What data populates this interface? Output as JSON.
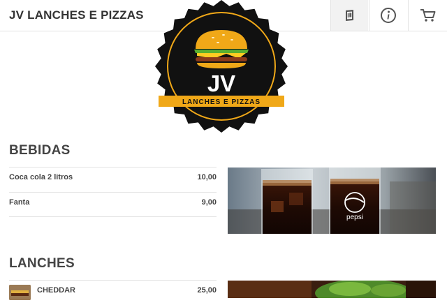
{
  "header": {
    "title": "JV LANCHES E PIZZAS",
    "buttons": [
      {
        "icon": "menu-book-icon"
      },
      {
        "icon": "info-icon"
      },
      {
        "icon": "cart-icon"
      }
    ]
  },
  "logo": {
    "initials": "JV",
    "tagline": "LANCHES E PIZZAS",
    "colors": {
      "badge": "#111111",
      "ring": "#f0a818",
      "banner": "#f0a818"
    }
  },
  "sections": [
    {
      "title": "BEBIDAS",
      "items": [
        {
          "name": "Coca cola 2 litros",
          "price": "10,00"
        },
        {
          "name": "Fanta",
          "price": "9,00"
        }
      ],
      "image": {
        "label": "pepsi"
      }
    },
    {
      "title": "LANCHES",
      "items": [
        {
          "name": "CHEDDAR",
          "price": "25,00"
        }
      ]
    }
  ]
}
